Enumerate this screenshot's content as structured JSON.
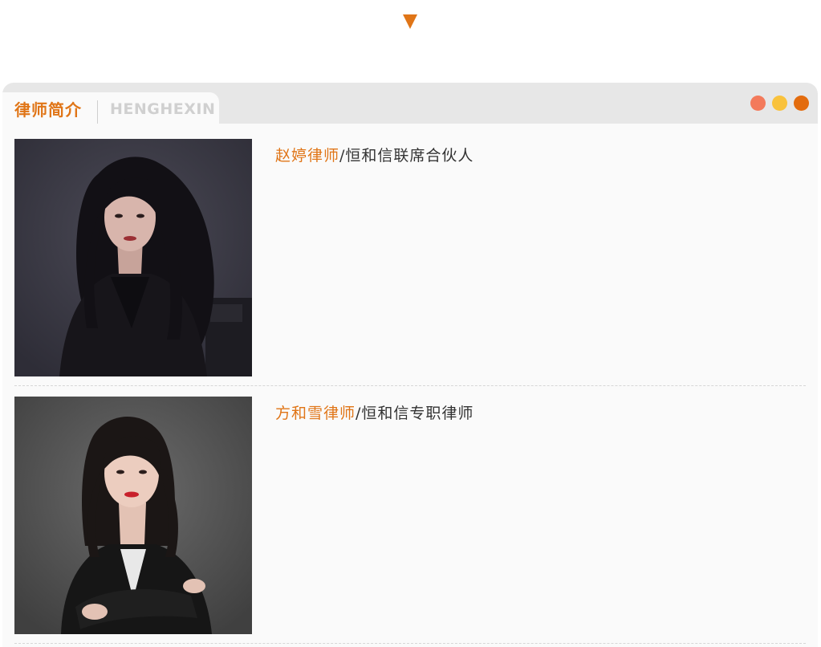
{
  "header": {
    "tab_title": "律师简介",
    "tab_subtitle": "HENGHEXIN"
  },
  "colors": {
    "accent": "#e07517",
    "dot_coral": "#f37a5b",
    "dot_yellow": "#f9c23c",
    "dot_orange": "#e36c0e"
  },
  "lawyers": [
    {
      "name": "赵婷律师",
      "role": "/恒和信联席合伙人",
      "photo_icon": "portrait-photo"
    },
    {
      "name": "方和雪律师",
      "role": "/恒和信专职律师",
      "photo_icon": "portrait-photo"
    }
  ]
}
